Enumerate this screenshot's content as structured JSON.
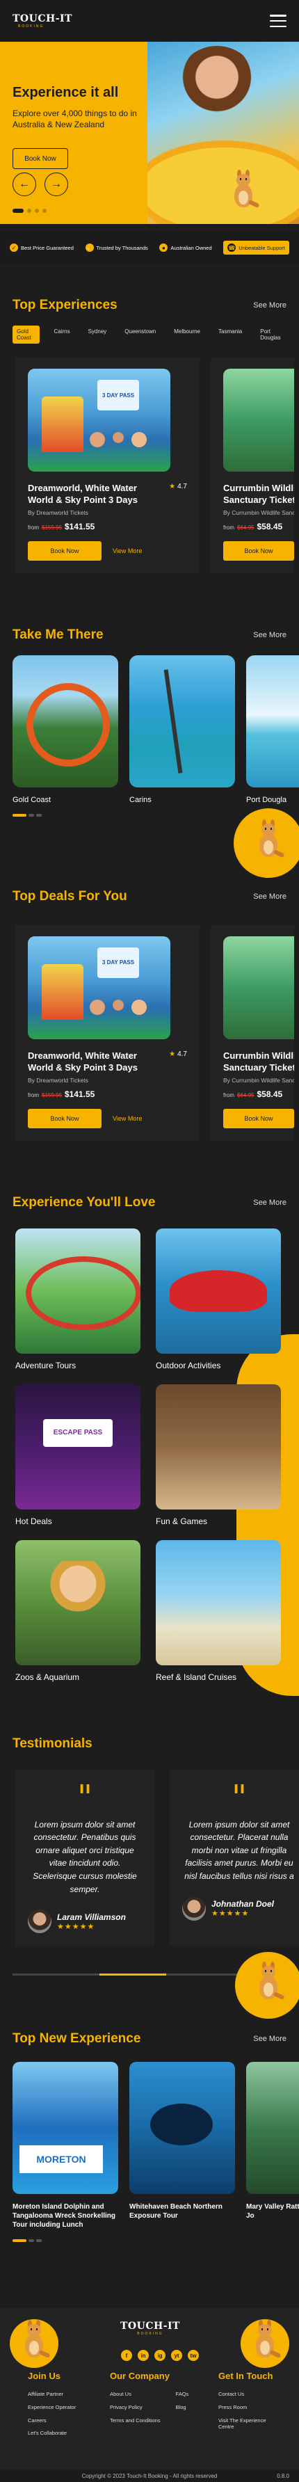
{
  "brand": {
    "name": "TOUCH-IT",
    "tagline": "BOOKING"
  },
  "hero": {
    "title": "Experience it all",
    "subtitle": "Explore over 4,000 things to do in Australia & New Zealand",
    "cta": "Book Now",
    "prev_icon": "arrow-left-icon",
    "next_icon": "arrow-right-icon",
    "slides_total": 4,
    "slide_active": 1
  },
  "features": [
    {
      "label": "Best Price Guaranteed"
    },
    {
      "label": "Trusted by Thousands"
    },
    {
      "label": "Australian Owned"
    },
    {
      "label": "Unbeatable Support"
    }
  ],
  "top_experiences": {
    "title": "Top Experiences",
    "see_more": "See More",
    "filters": [
      "Gold Coast",
      "Cairns",
      "Sydney",
      "Queenstown",
      "Melbourne",
      "Tasmania",
      "Port Douglas"
    ],
    "cards": [
      {
        "title": "Dreamworld, White Water World & Sky Point 3 Days",
        "rating": "4.7",
        "by": "By Dreamworld Tickets",
        "from": "from",
        "old_price": "$159.95",
        "price": "$141.55",
        "book": "Book Now",
        "view": "View More",
        "ticket": "3 DAY PASS"
      },
      {
        "title": "Currumbin Wildlife Sanctuary Tickets",
        "by": "By Currumbin Wildlife Sanctuary",
        "from": "from",
        "old_price": "$64.95",
        "price": "$58.45",
        "book": "Book Now"
      }
    ]
  },
  "take_me_there": {
    "title": "Take Me There",
    "see_more": "See More",
    "items": [
      {
        "label": "Gold Coast"
      },
      {
        "label": "Carins"
      },
      {
        "label": "Port Dougla"
      }
    ]
  },
  "top_deals": {
    "title": "Top Deals For You",
    "see_more": "See More",
    "cards": [
      {
        "title": "Dreamworld, White Water World & Sky Point 3 Days",
        "rating": "4.7",
        "by": "By Dreamworld Tickets",
        "from": "from",
        "old_price": "$159.95",
        "price": "$141.55",
        "book": "Book Now",
        "view": "View More",
        "ticket": "3 DAY PASS"
      },
      {
        "title": "Currumbin Wildlife Sanctuary Tickets",
        "by": "By Currumbin Wildlife Sanctuary",
        "from": "from",
        "old_price": "$64.95",
        "price": "$58.45",
        "book": "Book Now"
      }
    ]
  },
  "experience_love": {
    "title": "Experience You'll Love",
    "see_more": "See More",
    "items": [
      {
        "label": "Adventure Tours"
      },
      {
        "label": "Outdoor Activities"
      },
      {
        "label": "Hot Deals"
      },
      {
        "label": "Fun & Games"
      },
      {
        "label": "Zoos & Aquarium"
      },
      {
        "label": "Reef & Island Cruises"
      }
    ]
  },
  "testimonials": {
    "title": "Testimonials",
    "items": [
      {
        "text": "Lorem ipsum dolor sit amet consectetur. Penatibus quis ornare aliquet orci tristique vitae tincidunt odio. Scelerisque cursus molestie semper.",
        "name": "Laram Villiamson",
        "stars": "★★★★★"
      },
      {
        "text": "Lorem ipsum dolor sit amet consectetur. Placerat nulla morbi non vitae ut fringilla facilisis amet purus. Morbi eu nisl faucibus tellus nisi risus a",
        "name": "Johnathan Doel",
        "stars": "★★★★★"
      }
    ]
  },
  "new_experience": {
    "title": "Top New Experience",
    "see_more": "See More",
    "items": [
      {
        "label": "Moreton Island Dolphin and Tangalooma Wreck Snorkelling Tour including Lunch"
      },
      {
        "label": "Whitehaven Beach Northern Exposure Tour"
      },
      {
        "label": "Mary Valley Ratt Railway Tram Jo"
      }
    ]
  },
  "footer": {
    "socials": [
      "f",
      "in",
      "ig",
      "yt",
      "tw"
    ],
    "join_us": {
      "title": "Join Us",
      "links": [
        "Affiliate Partner",
        "Experience Operator",
        "Careers",
        "Let's Collaborate"
      ]
    },
    "our_company": {
      "title": "Our Company",
      "links_a": [
        "About Us",
        "Privacy Policy",
        "Terms and Conditions"
      ],
      "links_b": [
        "FAQs",
        "Blog"
      ]
    },
    "get_in_touch": {
      "title": "Get In Touch",
      "links": [
        "Contact Us",
        "Press Room",
        "Visit The Experience Centre"
      ]
    },
    "copyright": "Copyright © 2023 Touch-It Booking - All rights reserved",
    "version": "0.8.0"
  },
  "colors": {
    "accent": "#f6b400",
    "background": "#1d1d1d",
    "card": "#232323"
  }
}
